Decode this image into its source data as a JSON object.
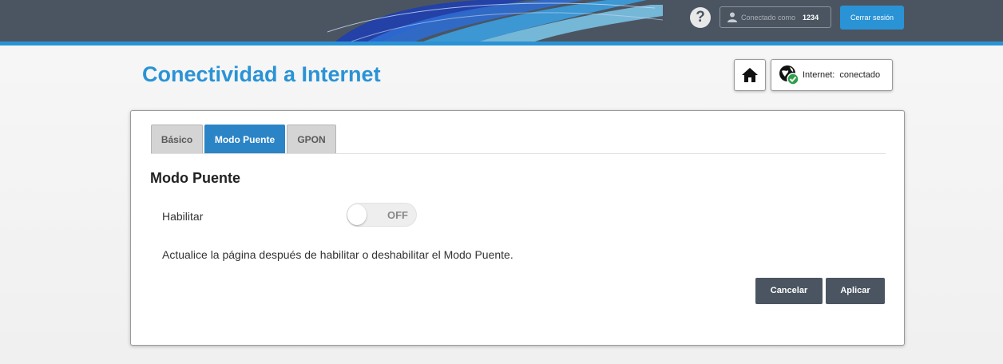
{
  "header": {
    "help_label": "?",
    "connected_as_label": "Conectado como",
    "username": "1234",
    "logout_label": "Cerrar sesión"
  },
  "page": {
    "title": "Conectividad a Internet",
    "status_label": "Internet:",
    "status_value": "conectado"
  },
  "tabs": [
    {
      "label": "Básico",
      "active": false
    },
    {
      "label": "Modo Puente",
      "active": true
    },
    {
      "label": "GPON",
      "active": false
    }
  ],
  "bridge": {
    "section_title": "Modo Puente",
    "enable_label": "Habilitar",
    "toggle_state": "OFF",
    "info_text": "Actualice la página después de habilitar o deshabilitar el Modo Puente."
  },
  "actions": {
    "cancel_label": "Cancelar",
    "apply_label": "Aplicar"
  },
  "colors": {
    "accent": "#2a93d5",
    "header_bg": "#4b5561",
    "active_tab": "#2a84c6",
    "status_ok": "#2e9e4a"
  },
  "icons": {
    "home": "home-icon",
    "internet_status": "globe-check-icon",
    "user": "user-icon"
  }
}
